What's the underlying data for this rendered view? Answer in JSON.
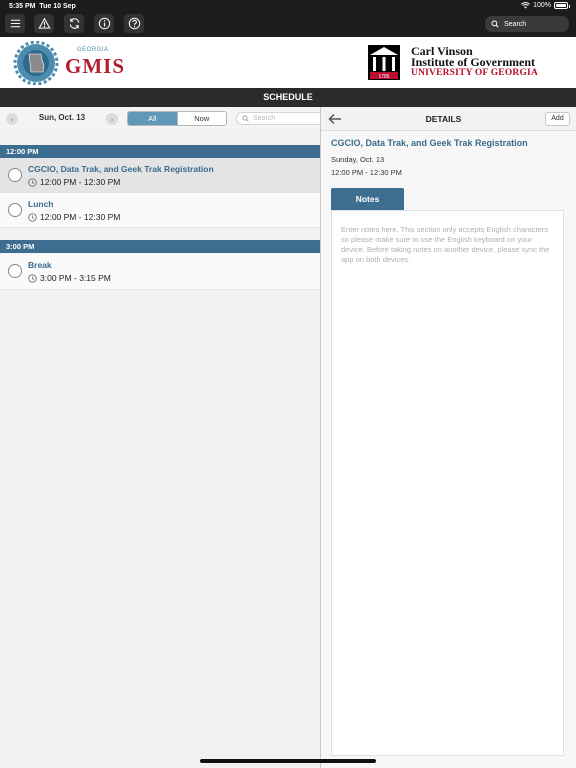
{
  "status": {
    "time": "5:35 PM",
    "date": "Tue 10 Sep",
    "battery": "100%",
    "battery_level": 1.0
  },
  "toolbar": {
    "icons": [
      "menu-icon",
      "alert-icon",
      "sync-icon",
      "info-icon",
      "help-icon"
    ],
    "search_placeholder": "Search"
  },
  "header": {
    "left_logo": {
      "small_text": "GEORGIA",
      "big_text": "GMIS"
    },
    "right_logo": {
      "line1": "Carl Vinson",
      "line2": "Institute of Government",
      "line3": "UNIVERSITY OF GEORGIA",
      "year": "1785",
      "color": "#ba0c2f"
    }
  },
  "schedule_title": "SCHEDULE",
  "filter": {
    "date": "Sun, Oct. 13",
    "tabs": [
      {
        "label": "All",
        "active": true
      },
      {
        "label": "Now",
        "active": false
      }
    ],
    "search_placeholder": "Search"
  },
  "schedule_groups": [
    {
      "time": "12:00 PM",
      "sessions": [
        {
          "title": "CGCIO, Data Trak, and Geek Trak Registration",
          "time": "12:00 PM - 12:30 PM",
          "selected": true
        },
        {
          "title": "Lunch",
          "time": "12:00 PM - 12:30 PM",
          "selected": false
        }
      ]
    },
    {
      "time": "3:00 PM",
      "sessions": [
        {
          "title": "Break",
          "time": "3:00 PM - 3:15 PM",
          "selected": false
        }
      ]
    }
  ],
  "details": {
    "header": "DETAILS",
    "add_label": "Add",
    "title": "CGCIO, Data Trak, and Geek Trak Registration",
    "date": "Sunday, Oct. 13",
    "time": "12:00 PM - 12:30 PM",
    "notes_tab": "Notes",
    "notes_placeholder": "Enter notes here. This section only accepts English characters so please make sure to use the English keyboard on your device. Before taking notes on another device, please sync the app on both devices."
  },
  "colors": {
    "accent": "#3d6e8f",
    "link": "#3a6b8d",
    "segment_active": "#5f98b8"
  }
}
